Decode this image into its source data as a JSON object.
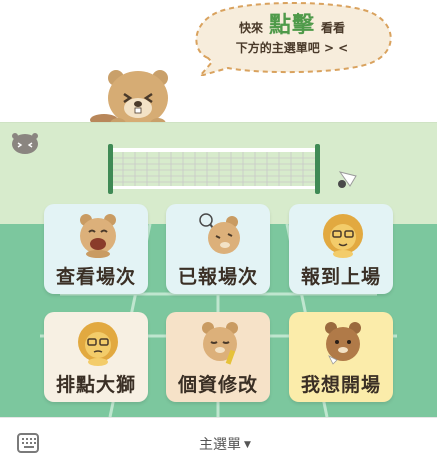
{
  "bubble": {
    "line1_prefix": "快來",
    "line1_highlight": "點擊",
    "line1_suffix": "看看",
    "line2": "下方的主選單吧 > <"
  },
  "menu": {
    "items": [
      {
        "label": "查看場次",
        "icon": "beaver-laughing-icon"
      },
      {
        "label": "已報場次",
        "icon": "beaver-racket-icon"
      },
      {
        "label": "報到上場",
        "icon": "lion-glasses-icon"
      },
      {
        "label": "排點大獅",
        "icon": "lion-glasses-icon"
      },
      {
        "label": "個資修改",
        "icon": "beaver-writing-icon"
      },
      {
        "label": "我想開場",
        "icon": "beaver-shuttlecock-icon"
      }
    ],
    "colors": {
      "sky": "#d7ebcc",
      "court": "#7cc79e",
      "tile_blue": "#e3f3f5",
      "tile_cream": "#f7f0e3",
      "tile_peach": "#f6e2c8",
      "tile_yellow": "#fbecaa"
    }
  },
  "bottom_bar": {
    "menu_label": "主選單",
    "keyboard_icon": "keyboard-icon",
    "caret_icon": "caret-down-icon"
  }
}
